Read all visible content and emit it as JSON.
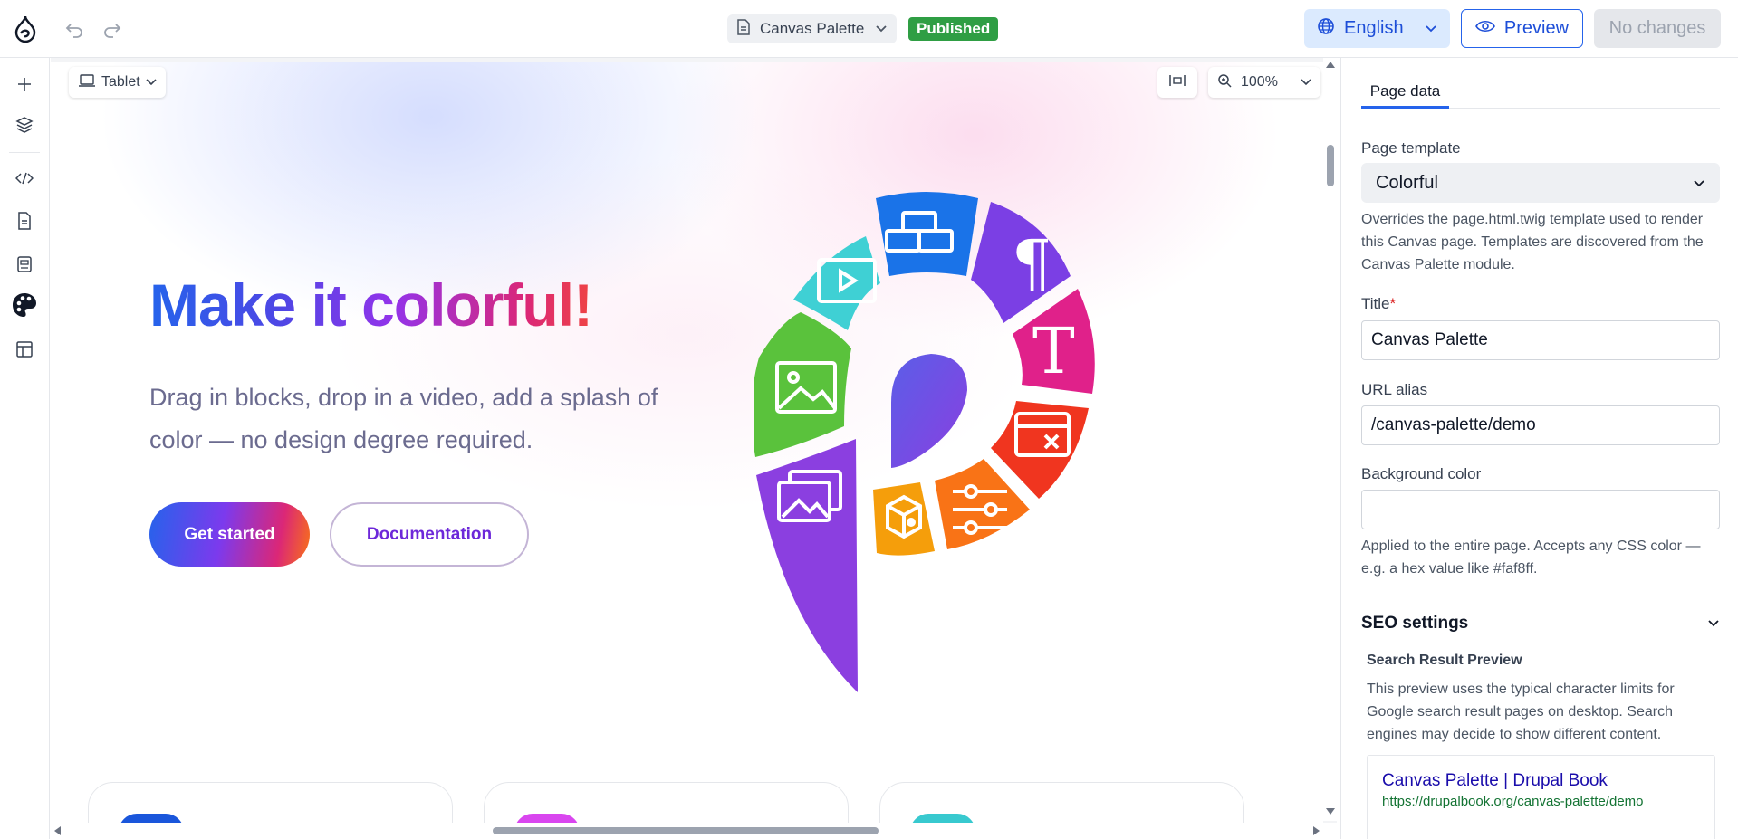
{
  "topbar": {
    "undo_label": "Undo",
    "redo_label": "Redo",
    "page_name": "Canvas Palette",
    "status": "Published",
    "language": "English",
    "preview_label": "Preview",
    "publish_label": "No changes"
  },
  "rail": {
    "items": [
      "add-icon",
      "layers-icon",
      "code-icon",
      "page-icon",
      "template-icon",
      "palette-icon",
      "layout-icon"
    ]
  },
  "canvas_toolbar": {
    "device": "Tablet",
    "zoom": "100%"
  },
  "hero": {
    "title_part1": "Make ",
    "title_part2": "it colorful!",
    "subtitle": "Drag in blocks, drop in a video, add a splash of color — no design degree required.",
    "primary_cta": "Get started",
    "secondary_cta": "Documentation"
  },
  "colors": {
    "accent": "#2563eb",
    "published": "#2f9e44",
    "wheel": [
      "#1a73e8",
      "#7b3fe4",
      "#e0218a",
      "#f0351f",
      "#f97316",
      "#f59e0b",
      "#8b3fe0",
      "#5ac23c",
      "#3fd0d4"
    ],
    "card_chips": [
      "#1a56db",
      "#d946ef",
      "#38c9cf"
    ]
  },
  "panel": {
    "tab": "Page data",
    "template_label": "Page template",
    "template_value": "Colorful",
    "template_help": "Overrides the page.html.twig template used to render this Canvas page. Templates are discovered from the Canvas Palette module.",
    "title_label": "Title",
    "required_mark": "*",
    "title_value": "Canvas Palette",
    "alias_label": "URL alias",
    "alias_value": "/canvas-palette/demo",
    "bg_label": "Background color",
    "bg_value": "",
    "bg_help": "Applied to the entire page. Accepts any CSS color — e.g. a hex value like #faf8ff.",
    "seo_label": "SEO settings",
    "srp_title": "Search Result Preview",
    "srp_help": "This preview uses the typical character limits for Google search result pages on desktop. Search engines may decide to show different content.",
    "srp_link": "Canvas Palette | Drupal Book",
    "srp_url": "https://drupalbook.org/canvas-palette/demo"
  }
}
